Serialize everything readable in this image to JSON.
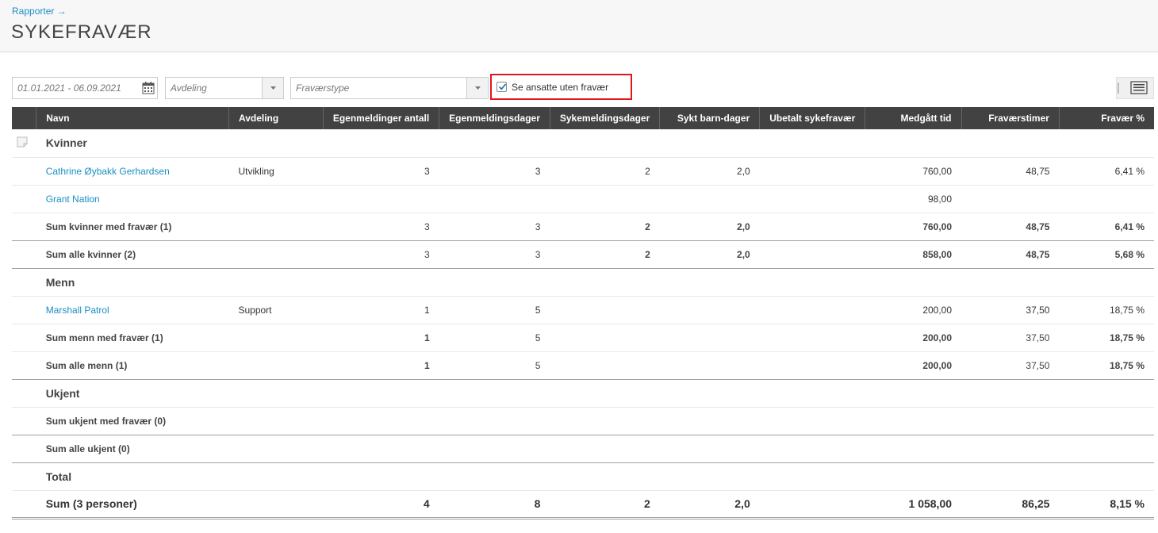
{
  "breadcrumb": "Rapporter →",
  "title": "SYKEFRAVÆR",
  "filters": {
    "date_range": "01.01.2021 - 06.09.2021",
    "department_placeholder": "Avdeling",
    "absence_type_placeholder": "Fraværstype",
    "show_without_absence_label": "Se ansatte uten fravær",
    "show_without_absence_checked": true
  },
  "table": {
    "headers": [
      "Navn",
      "Avdeling",
      "Egenmeldinger antall",
      "Egenmeldingsdager",
      "Sykemeldingsdager",
      "Sykt barn-dager",
      "Ubetalt sykefravær",
      "Medgått tid",
      "Fraværstimer",
      "Fravær %"
    ],
    "groups": {
      "kvinner": {
        "label": "Kvinner",
        "rows": [
          {
            "name": "Cathrine Øybakk Gerhardsen",
            "dept": "Utvikling",
            "egen_antall": "3",
            "egen_dager": "3",
            "syk_dager": "2",
            "barn_dager": "2,0",
            "ubetalt": "",
            "medgatt": "760,00",
            "timer": "48,75",
            "prosent": "6,41 %"
          },
          {
            "name": "Grant Nation",
            "dept": "",
            "egen_antall": "",
            "egen_dager": "",
            "syk_dager": "",
            "barn_dager": "",
            "ubetalt": "",
            "medgatt": "98,00",
            "timer": "",
            "prosent": ""
          }
        ],
        "sum_with": {
          "label": "Sum kvinner med fravær (1)",
          "egen_antall": "3",
          "egen_dager": "3",
          "syk_dager": "2",
          "barn_dager": "2,0",
          "medgatt": "760,00",
          "timer": "48,75",
          "prosent": "6,41 %"
        },
        "sum_all": {
          "label": "Sum alle kvinner (2)",
          "egen_antall": "3",
          "egen_dager": "3",
          "syk_dager": "2",
          "barn_dager": "2,0",
          "medgatt": "858,00",
          "timer": "48,75",
          "prosent": "5,68 %"
        }
      },
      "menn": {
        "label": "Menn",
        "rows": [
          {
            "name": "Marshall Patrol",
            "dept": "Support",
            "egen_antall": "1",
            "egen_dager": "5",
            "syk_dager": "",
            "barn_dager": "",
            "ubetalt": "",
            "medgatt": "200,00",
            "timer": "37,50",
            "prosent": "18,75 %"
          }
        ],
        "sum_with": {
          "label": "Sum menn med fravær (1)",
          "egen_antall": "1",
          "egen_dager": "5",
          "medgatt": "200,00",
          "timer": "37,50",
          "prosent": "18,75 %"
        },
        "sum_all": {
          "label": "Sum alle menn (1)",
          "egen_antall": "1",
          "egen_dager": "5",
          "medgatt": "200,00",
          "timer": "37,50",
          "prosent": "18,75 %"
        }
      },
      "ukjent": {
        "label": "Ukjent",
        "sum_with": {
          "label": "Sum ukjent med fravær (0)"
        },
        "sum_all": {
          "label": "Sum alle ukjent (0)"
        }
      }
    },
    "total": {
      "label": "Total",
      "sum_label": "Sum (3 personer)",
      "egen_antall": "4",
      "egen_dager": "8",
      "syk_dager": "2",
      "barn_dager": "2,0",
      "medgatt": "1 058,00",
      "timer": "86,25",
      "prosent": "8,15 %"
    }
  },
  "colors": {
    "link": "#1a8fc4",
    "header_bg": "#424242",
    "highlight": "#e0161b"
  }
}
